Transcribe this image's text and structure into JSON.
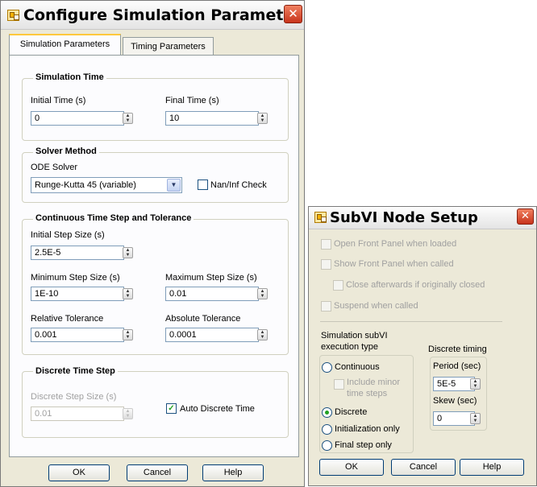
{
  "left_dialog": {
    "title": "Configure Simulation Paramet...",
    "close_glyph": "✕",
    "tabs": [
      {
        "label": "Simulation Parameters",
        "active": true
      },
      {
        "label": "Timing Parameters",
        "active": false
      }
    ],
    "simulation_time": {
      "title": "Simulation Time",
      "initial_time_label": "Initial Time (s)",
      "initial_time_value": "0",
      "final_time_label": "Final Time (s)",
      "final_time_value": "10"
    },
    "solver_method": {
      "title": "Solver Method",
      "ode_solver_label": "ODE Solver",
      "ode_solver_value": "Runge-Kutta 45 (variable)",
      "nan_inf_check_label": "Nan/Inf Check",
      "nan_inf_check_checked": false
    },
    "continuous_step": {
      "title": "Continuous Time Step and Tolerance",
      "initial_step_label": "Initial Step Size (s)",
      "initial_step_value": "2.5E-5",
      "min_step_label": "Minimum Step Size (s)",
      "min_step_value": "1E-10",
      "max_step_label": "Maximum Step Size (s)",
      "max_step_value": "0.01",
      "rel_tol_label": "Relative Tolerance",
      "rel_tol_value": "0.001",
      "abs_tol_label": "Absolute Tolerance",
      "abs_tol_value": "0.0001"
    },
    "discrete_step": {
      "title": "Discrete Time Step",
      "step_size_label": "Discrete Step Size (s)",
      "step_size_value": "0.01",
      "auto_discrete_label": "Auto Discrete Time",
      "auto_discrete_checked": true
    },
    "buttons": {
      "ok": "OK",
      "cancel": "Cancel",
      "help": "Help"
    }
  },
  "right_dialog": {
    "title": "SubVI Node Setup",
    "close_glyph": "✕",
    "options": {
      "open_front_panel": "Open Front Panel when loaded",
      "show_front_panel": "Show Front Panel when called",
      "close_afterwards": "Close afterwards if originally closed",
      "suspend": "Suspend when called"
    },
    "exec_type": {
      "title_line1": "Simulation subVI",
      "title_line2": "execution type",
      "continuous": "Continuous",
      "include_minor_line1": "Include minor",
      "include_minor_line2": "time steps",
      "discrete": "Discrete",
      "init_only": "Initialization only",
      "final_step_only": "Final step only",
      "selected": "Discrete"
    },
    "discrete_timing": {
      "title": "Discrete timing",
      "period_label": "Period (sec)",
      "period_value": "5E-5",
      "skew_label": "Skew (sec)",
      "skew_value": "0"
    },
    "buttons": {
      "ok": "OK",
      "cancel": "Cancel",
      "help": "Help"
    }
  },
  "icons": [
    "labview-vi-icon",
    "close-icon",
    "spin-arrows-icon",
    "dropdown-arrow-icon",
    "checkmark-icon"
  ],
  "colors": {
    "accent_tab": "#ffc83c",
    "close_button": "#d8482c",
    "check_green": "#21a121"
  }
}
